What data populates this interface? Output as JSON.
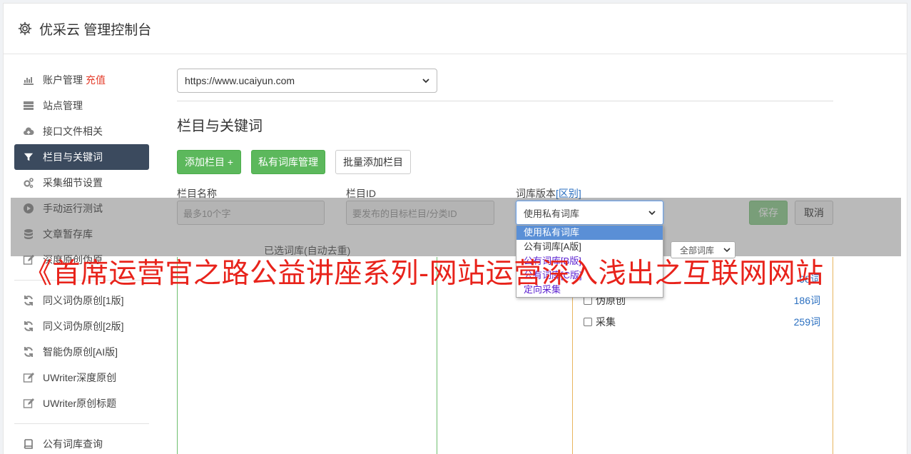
{
  "header": {
    "title": "优采云 管理控制台",
    "icon": "gear-icon"
  },
  "sidebar": {
    "items": [
      {
        "label": "账户管理",
        "extra": "充值",
        "icon": "bar-chart-icon"
      },
      {
        "label": "站点管理",
        "icon": "server-icon"
      },
      {
        "label": "接口文件相关",
        "icon": "cloud-upload-icon"
      },
      {
        "label": "栏目与关键词",
        "icon": "filter-icon",
        "active": true
      },
      {
        "label": "采集细节设置",
        "icon": "gears-icon"
      },
      {
        "label": "手动运行测试",
        "icon": "play-circle-icon"
      },
      {
        "label": "文章暂存库",
        "icon": "database-icon"
      },
      {
        "label": "深度原创伪原",
        "icon": "edit-icon"
      },
      {
        "label": "同义词伪原创[1版]",
        "icon": "refresh-icon"
      },
      {
        "label": "同义词伪原创[2版]",
        "icon": "refresh-icon"
      },
      {
        "label": "智能伪原创[AI版]",
        "icon": "refresh-icon"
      },
      {
        "label": "UWriter深度原创",
        "icon": "edit-icon"
      },
      {
        "label": "UWriter原创标题",
        "icon": "edit-icon"
      },
      {
        "label": "公有词库查询",
        "icon": "book-icon"
      }
    ]
  },
  "main": {
    "site_select": "https://www.ucaiyun.com",
    "section_title": "栏目与关键词",
    "buttons": {
      "add_column": "添加栏目 +",
      "private_lib": "私有词库管理",
      "batch_add": "批量添加栏目",
      "save": "保存",
      "cancel": "取消"
    },
    "form": {
      "name_label": "栏目名称",
      "name_placeholder": "最多10个字",
      "id_label": "栏目ID",
      "id_placeholder": "要发布的目标栏目/分类ID",
      "lib_label": "词库版本",
      "lib_link": "[区别]",
      "lib_value": "使用私有词库"
    },
    "dropdown": {
      "options": [
        "使用私有词库",
        "公有词库[A版]",
        "公有词库[B版]",
        "公有词库[C版]",
        "定向采集"
      ]
    },
    "selected_lib_label": "已选词库(自动去重)",
    "all_lib_select": "全部词库",
    "libs": [
      {
        "name": "",
        "count": "98词"
      },
      {
        "name": "伪原创",
        "count": "186词"
      },
      {
        "name": "采集",
        "count": "259词"
      }
    ]
  },
  "watermark": "《首席运营官之路公益讲座系列-网站运营深入浅出之互联网网站",
  "colors": {
    "active_nav": "#3b4a5e",
    "green": "#5cb85c",
    "link": "#2a6fc0",
    "watermark": "#e8231b",
    "recharge": "#e43d2b"
  }
}
